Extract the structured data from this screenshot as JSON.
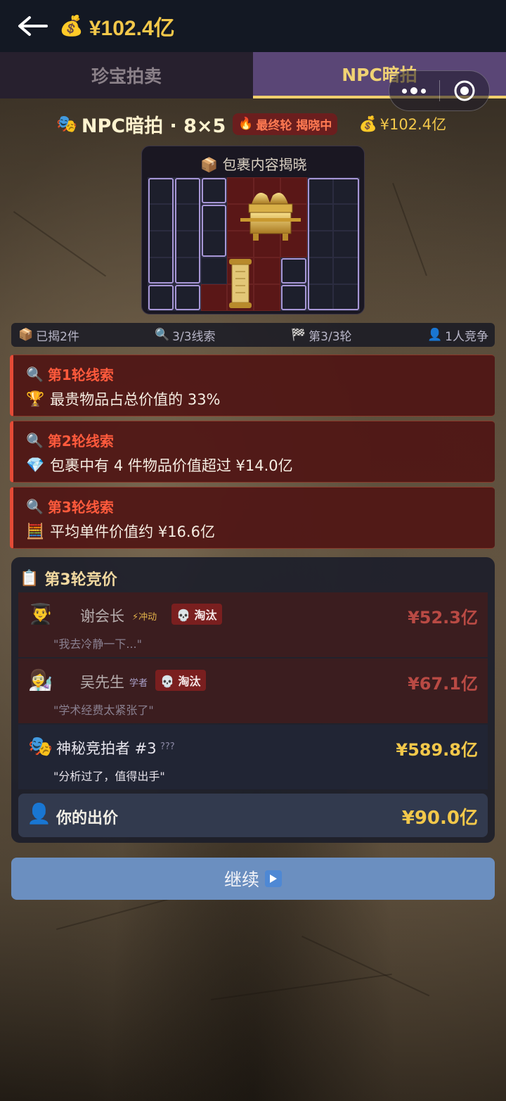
{
  "topbar": {
    "balance": "¥102.4亿",
    "money_icon": "money-bag-icon"
  },
  "tabs": [
    {
      "label": "珍宝拍卖",
      "active": false
    },
    {
      "label": "NPC暗拍",
      "active": true
    }
  ],
  "header": {
    "title": "NPC暗拍 · 8×5",
    "badge": "最终轮 揭晓中",
    "balance": "¥102.4亿"
  },
  "reveal": {
    "title": "包裹内容揭晓"
  },
  "stats": {
    "revealed": "已揭2件",
    "clues": "3/3线索",
    "round": "第3/3轮",
    "competitors": "1人竞争"
  },
  "clues": [
    {
      "title": "第1轮线索",
      "icon": "trophy-icon",
      "text": "最贵物品占总价值的 33%"
    },
    {
      "title": "第2轮线索",
      "icon": "diamond-icon",
      "text": "包裹中有 4 件物品价值超过 ¥14.0亿"
    },
    {
      "title": "第3轮线索",
      "icon": "abacus-icon",
      "text": "平均单件价值约 ¥16.6亿"
    }
  ],
  "bidding": {
    "title": "第3轮竞价",
    "bidders": [
      {
        "name": "谢会长",
        "tag": "⚡冲动",
        "status": "💀 淘汰",
        "amount": "¥52.3亿",
        "quote": "\"我去冷静一下...\""
      },
      {
        "name": "吴先生",
        "tag": "学者",
        "status": "💀 淘汰",
        "amount": "¥67.1亿",
        "quote": "\"学术经费太紧张了\""
      },
      {
        "name": "神秘竞拍者 #3",
        "tag": "???",
        "status": "",
        "amount": "¥589.8亿",
        "quote": "\"分析过了，值得出手\""
      }
    ],
    "your_bid_label": "你的出价",
    "your_bid_amount": "¥90.0亿"
  },
  "continue_label": "继续",
  "colors": {
    "gold": "#f3c84a",
    "clue_red": "#ff5a3c",
    "continue_blue": "#6b8fc0",
    "tab_active": "#5a4676"
  }
}
